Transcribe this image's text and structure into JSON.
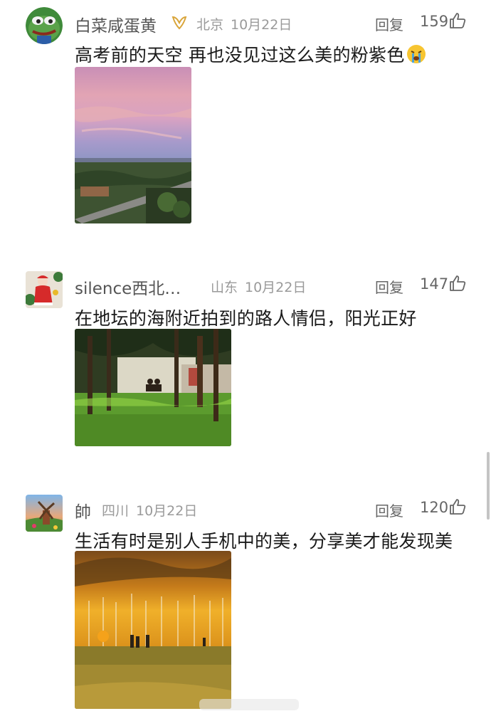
{
  "comments": [
    {
      "username": "白菜咸蛋黄",
      "location": "北京",
      "date": "10月22日",
      "reply_label": "回复",
      "likes": "159",
      "text": "高考前的天空 再也没见过这么美的粉紫色",
      "avatar_icon": "frog-avatar-icon",
      "badge_icon": "ribbon-badge-icon",
      "text_emoji": "crying-face-emoji"
    },
    {
      "username": "silence西北…",
      "location": "山东",
      "date": "10月22日",
      "reply_label": "回复",
      "likes": "147",
      "text": "在地坛的海附近拍到的路人情侣，阳光正好",
      "avatar_icon": "christmas-avatar-icon"
    },
    {
      "username": "帥",
      "location": "四川",
      "date": "10月22日",
      "reply_label": "回复",
      "likes": "120",
      "text": "生活有时是别人手机中的美，分享美才能发现美",
      "avatar_icon": "windmill-avatar-icon"
    }
  ],
  "colors": {
    "username": "#555555",
    "meta": "#9a9a9a",
    "text": "#1a1a1a",
    "badge": "#d9a53a"
  }
}
